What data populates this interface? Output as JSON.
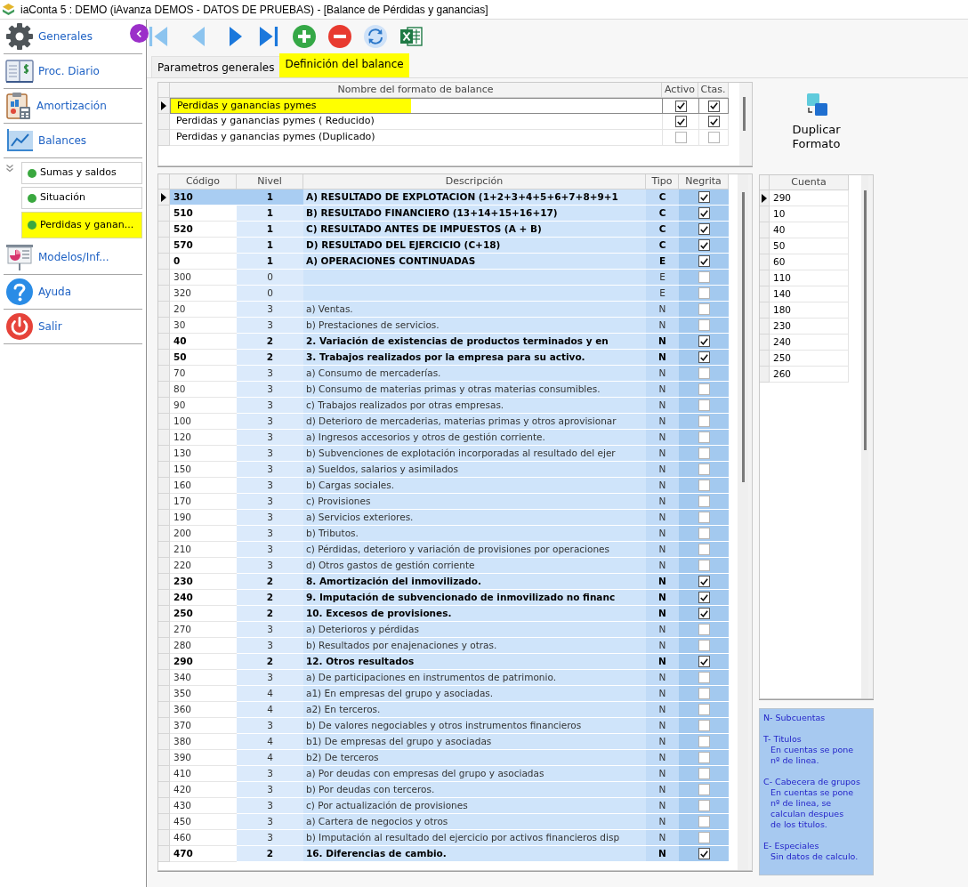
{
  "window": {
    "title": "iaConta 5 : DEMO (iAvanza DEMOS - DATOS DE PRUEBAS) - [Balance de Pérdidas y ganancias]"
  },
  "sidebar": {
    "items": [
      {
        "label": "Generales"
      },
      {
        "label": "Proc. Diario"
      },
      {
        "label": "Amortización"
      },
      {
        "label": "Balances",
        "expanded": true,
        "children": [
          {
            "label": "Sumas y saldos",
            "selected": false
          },
          {
            "label": "Situación",
            "selected": false
          },
          {
            "label": "Perdidas y ganan...",
            "selected": true
          }
        ]
      },
      {
        "label": "Modelos/Inf..."
      },
      {
        "label": "Ayuda"
      },
      {
        "label": "Salir"
      }
    ]
  },
  "tabs": [
    {
      "label": "Parametros generales",
      "selected": false
    },
    {
      "label": "Definición del balance",
      "selected": true
    }
  ],
  "format_table": {
    "columns": [
      "Nombre del formato de balance",
      "Activo",
      "Ctas."
    ],
    "rows": [
      {
        "name": "Perdidas y ganancias pymes",
        "activo": true,
        "ctas": true,
        "selected": true
      },
      {
        "name": "Perdidas y ganancias pymes ( Reducido)",
        "activo": true,
        "ctas": true,
        "selected": false
      },
      {
        "name": "Perdidas y ganancias pymes (Duplicado)",
        "activo": false,
        "ctas": false,
        "selected": false
      }
    ]
  },
  "duplicate_button": {
    "label": "Duplicar Formato"
  },
  "lines_table": {
    "columns": [
      "Código",
      "Nivel",
      "Descripción",
      "Tipo",
      "Negrita"
    ],
    "rows": [
      {
        "codigo": "310",
        "nivel": "1",
        "descripcion": "A) RESULTADO DE EXPLOTACION (1+2+3+4+5+6+7+8+9+1",
        "tipo": "C",
        "negrita": true,
        "selected": true
      },
      {
        "codigo": "510",
        "nivel": "1",
        "descripcion": "B) RESULTADO FINANCIERO (13+14+15+16+17)",
        "tipo": "C",
        "negrita": true,
        "selected": false
      },
      {
        "codigo": "520",
        "nivel": "1",
        "descripcion": "C) RESULTADO ANTES DE IMPUESTOS (A + B)",
        "tipo": "C",
        "negrita": true,
        "selected": false
      },
      {
        "codigo": "570",
        "nivel": "1",
        "descripcion": "D) RESULTADO DEL EJERCICIO (C+18)",
        "tipo": "C",
        "negrita": true,
        "selected": false
      },
      {
        "codigo": "0",
        "nivel": "1",
        "descripcion": "A) OPERACIONES CONTINUADAS",
        "tipo": "E",
        "negrita": true,
        "selected": false
      },
      {
        "codigo": "300",
        "nivel": "0",
        "tipo": "E",
        "negrita": false,
        "selected": false
      },
      {
        "codigo": "320",
        "nivel": "0",
        "tipo": "E",
        "negrita": false,
        "selected": false
      },
      {
        "codigo": "20",
        "nivel": "3",
        "descripcion": "a) Ventas.",
        "tipo": "N",
        "negrita": false,
        "selected": false
      },
      {
        "codigo": "30",
        "nivel": "3",
        "descripcion": "b) Prestaciones de servicios.",
        "tipo": "N",
        "negrita": false,
        "selected": false
      },
      {
        "codigo": "40",
        "nivel": "2",
        "descripcion": "2. Variación de existencias de productos terminados y en",
        "tipo": "N",
        "negrita": true,
        "selected": false
      },
      {
        "codigo": "50",
        "nivel": "2",
        "descripcion": "3. Trabajos realizados por la empresa para su activo.",
        "tipo": "N",
        "negrita": true,
        "selected": false
      },
      {
        "codigo": "70",
        "nivel": "3",
        "descripcion": "a) Consumo de mercaderías.",
        "tipo": "N",
        "negrita": false,
        "selected": false
      },
      {
        "codigo": "80",
        "nivel": "3",
        "descripcion": "b) Consumo de materias primas y otras materias consumibles.",
        "tipo": "N",
        "negrita": false,
        "selected": false
      },
      {
        "codigo": "90",
        "nivel": "3",
        "descripcion": "c) Trabajos realizados por otras empresas.",
        "tipo": "N",
        "negrita": false,
        "selected": false
      },
      {
        "codigo": "100",
        "nivel": "3",
        "descripcion": "d) Deterioro de mercaderias, materias primas y otros aprovisionar",
        "tipo": "N",
        "negrita": false,
        "selected": false
      },
      {
        "codigo": "120",
        "nivel": "3",
        "descripcion": "a) Ingresos accesorios y otros de gestión corriente.",
        "tipo": "N",
        "negrita": false,
        "selected": false
      },
      {
        "codigo": "130",
        "nivel": "3",
        "descripcion": "b) Subvenciones de explotación incorporadas al resultado del ejer",
        "tipo": "N",
        "negrita": false,
        "selected": false
      },
      {
        "codigo": "150",
        "nivel": "3",
        "descripcion": "a) Sueldos, salarios y asimilados",
        "tipo": "N",
        "negrita": false,
        "selected": false
      },
      {
        "codigo": "160",
        "nivel": "3",
        "descripcion": "b) Cargas sociales.",
        "tipo": "N",
        "negrita": false,
        "selected": false
      },
      {
        "codigo": "170",
        "nivel": "3",
        "descripcion": "c) Provisiones",
        "tipo": "N",
        "negrita": false,
        "selected": false
      },
      {
        "codigo": "190",
        "nivel": "3",
        "descripcion": "a) Servicios exteriores.",
        "tipo": "N",
        "negrita": false,
        "selected": false
      },
      {
        "codigo": "200",
        "nivel": "3",
        "descripcion": "b) Tributos.",
        "tipo": "N",
        "negrita": false,
        "selected": false
      },
      {
        "codigo": "210",
        "nivel": "3",
        "descripcion": "c) Pérdidas, deterioro y variación de provisiones por operaciones",
        "tipo": "N",
        "negrita": false,
        "selected": false
      },
      {
        "codigo": "220",
        "nivel": "3",
        "descripcion": "d) Otros gastos de gestión corriente",
        "tipo": "N",
        "negrita": false,
        "selected": false
      },
      {
        "codigo": "230",
        "nivel": "2",
        "descripcion": "8. Amortización del inmovilizado.",
        "tipo": "N",
        "negrita": true,
        "selected": false
      },
      {
        "codigo": "240",
        "nivel": "2",
        "descripcion": "9. Imputación de subvencionado de inmovilizado no financ",
        "tipo": "N",
        "negrita": true,
        "selected": false
      },
      {
        "codigo": "250",
        "nivel": "2",
        "descripcion": "10. Excesos de provisiones.",
        "tipo": "N",
        "negrita": true,
        "selected": false
      },
      {
        "codigo": "270",
        "nivel": "3",
        "descripcion": "a) Deterioros y pérdidas",
        "tipo": "N",
        "negrita": false,
        "selected": false
      },
      {
        "codigo": "280",
        "nivel": "3",
        "descripcion": "b) Resultados por enajenaciones y otras.",
        "tipo": "N",
        "negrita": false,
        "selected": false
      },
      {
        "codigo": "290",
        "nivel": "2",
        "descripcion": "12. Otros resultados",
        "tipo": "N",
        "negrita": true,
        "selected": false
      },
      {
        "codigo": "340",
        "nivel": "3",
        "descripcion": "a) De participaciones en instrumentos de patrimonio.",
        "tipo": "N",
        "negrita": false,
        "selected": false
      },
      {
        "codigo": "350",
        "nivel": "4",
        "descripcion": "a1) En empresas del grupo y asociadas.",
        "tipo": "N",
        "negrita": false,
        "selected": false
      },
      {
        "codigo": "360",
        "nivel": "4",
        "descripcion": "a2) En terceros.",
        "tipo": "N",
        "negrita": false,
        "selected": false
      },
      {
        "codigo": "370",
        "nivel": "3",
        "descripcion": "b) De valores negociables y otros instrumentos financieros",
        "tipo": "N",
        "negrita": false,
        "selected": false
      },
      {
        "codigo": "380",
        "nivel": "4",
        "descripcion": "b1) De empresas del grupo y asociadas",
        "tipo": "N",
        "negrita": false,
        "selected": false
      },
      {
        "codigo": "390",
        "nivel": "4",
        "descripcion": "b2) De terceros",
        "tipo": "N",
        "negrita": false,
        "selected": false
      },
      {
        "codigo": "410",
        "nivel": "3",
        "descripcion": "a) Por deudas con empresas del grupo y asociadas",
        "tipo": "N",
        "negrita": false,
        "selected": false
      },
      {
        "codigo": "420",
        "nivel": "3",
        "descripcion": "b) Por deudas con terceros.",
        "tipo": "N",
        "negrita": false,
        "selected": false
      },
      {
        "codigo": "430",
        "nivel": "3",
        "descripcion": "c) Por actualización de provisiones",
        "tipo": "N",
        "negrita": false,
        "selected": false
      },
      {
        "codigo": "450",
        "nivel": "3",
        "descripcion": "a) Cartera de negocios y otros",
        "tipo": "N",
        "negrita": false,
        "selected": false
      },
      {
        "codigo": "460",
        "nivel": "3",
        "descripcion": "b) Imputación al resultado del ejercicio por activos financieros disp",
        "tipo": "N",
        "negrita": false,
        "selected": false
      },
      {
        "codigo": "470",
        "nivel": "2",
        "descripcion": "16. Diferencias de cambio.",
        "tipo": "N",
        "negrita": true,
        "selected": false
      }
    ]
  },
  "accounts_table": {
    "columns": [
      "Cuenta"
    ],
    "rows": [
      {
        "cuenta": "290",
        "selected": true
      },
      {
        "cuenta": "10",
        "selected": false
      },
      {
        "cuenta": "40",
        "selected": false
      },
      {
        "cuenta": "50",
        "selected": false
      },
      {
        "cuenta": "60",
        "selected": false
      },
      {
        "cuenta": "110",
        "selected": false
      },
      {
        "cuenta": "140",
        "selected": false
      },
      {
        "cuenta": "180",
        "selected": false
      },
      {
        "cuenta": "230",
        "selected": false
      },
      {
        "cuenta": "240",
        "selected": false
      },
      {
        "cuenta": "250",
        "selected": false
      },
      {
        "cuenta": "260",
        "selected": false
      }
    ]
  },
  "legend": [
    {
      "title": "N- Subcuentas"
    },
    {
      "title": "T- Titulos",
      "detail": "En cuentas se pone\nnº de linea."
    },
    {
      "title": "C- Cabecera de grupos",
      "detail": "En cuentas se pone\nnº de linea, se\ncalculan despues\nde los titulos."
    },
    {
      "title": "E- Especiales",
      "detail": "Sin datos de calculo."
    }
  ]
}
